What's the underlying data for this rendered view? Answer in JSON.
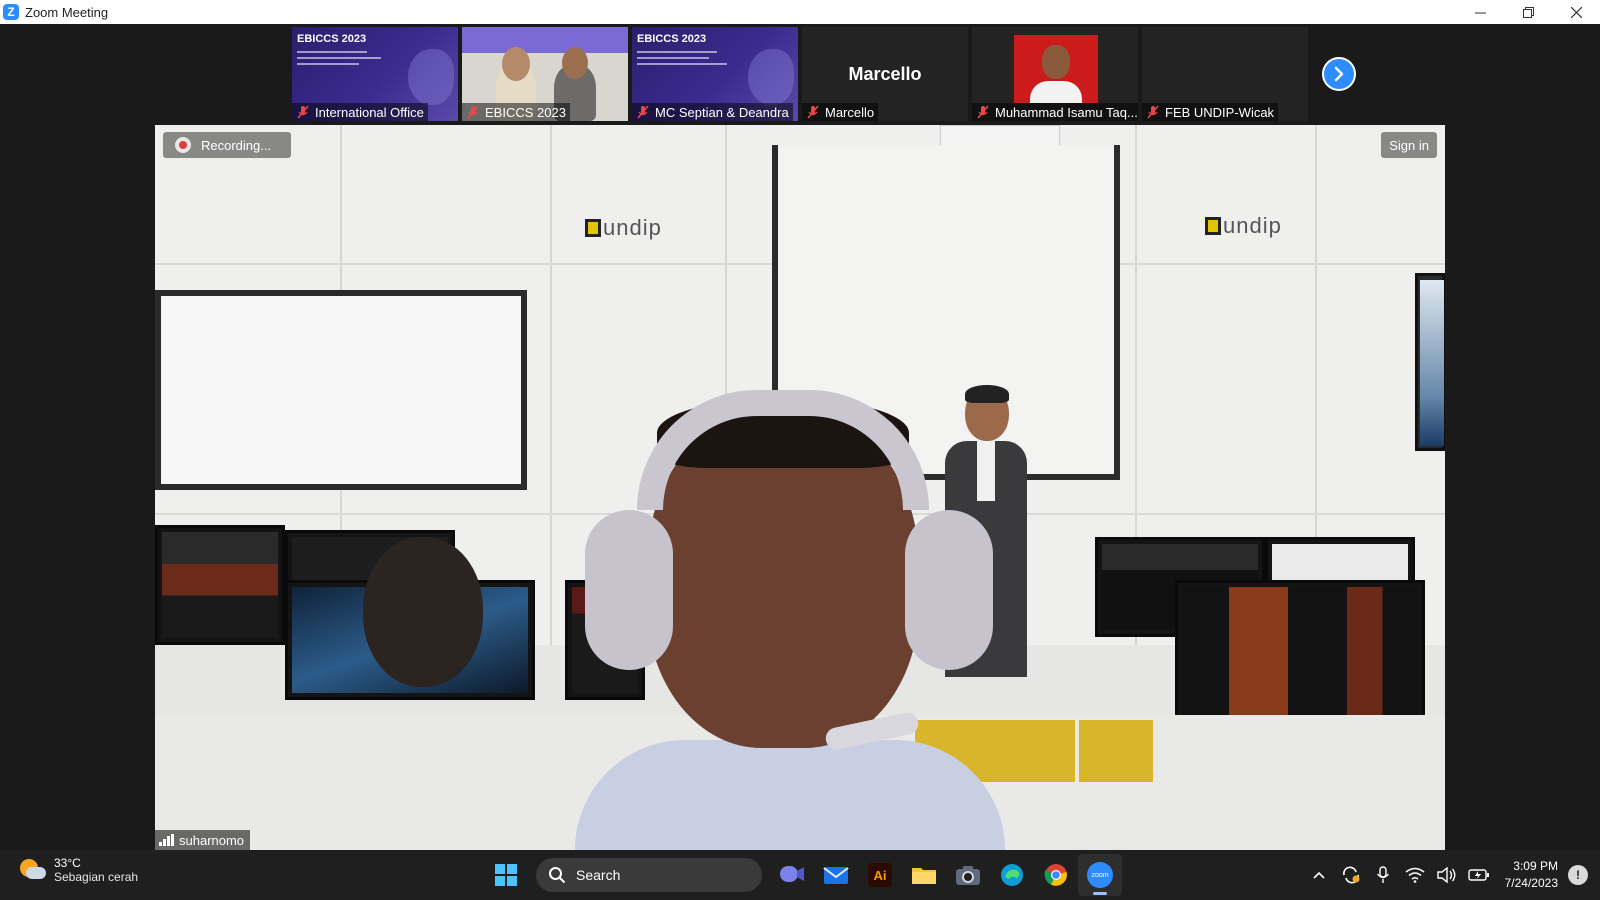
{
  "window": {
    "title": "Zoom Meeting",
    "app_icon_letter": "Z"
  },
  "gallery": {
    "participants": [
      {
        "name": "International Office",
        "slide_title": "EBICCS 2023",
        "muted": true
      },
      {
        "name": "EBICCS 2023",
        "muted": true
      },
      {
        "name": "MC Septian & Deandra",
        "slide_title": "EBICCS 2023",
        "muted": true
      },
      {
        "name": "Marcello",
        "display_name": "Marcello",
        "muted": true
      },
      {
        "name": "Muhammad Isamu Taq...",
        "muted": true
      },
      {
        "name": "FEB UNDIP-Wicak",
        "muted": true
      }
    ]
  },
  "main_video": {
    "recording_label": "Recording...",
    "sign_in_label": "Sign in",
    "speaker_name": "suharnomo",
    "wall_logo_text": "undip"
  },
  "taskbar": {
    "weather": {
      "temp": "33°C",
      "desc": "Sebagian cerah"
    },
    "search_label": "Search",
    "apps": [
      "meet-app",
      "mail",
      "adobe-illustrator",
      "file-explorer",
      "camera",
      "edge",
      "chrome",
      "zoom"
    ],
    "adobe_label": "Ai",
    "zoom_label": "zoom",
    "time": "3:09 PM",
    "date": "7/24/2023"
  },
  "colors": {
    "zoom_blue": "#2d8cff",
    "mute_red": "#e5484d",
    "taskbar_bg": "#1f1f1f"
  }
}
